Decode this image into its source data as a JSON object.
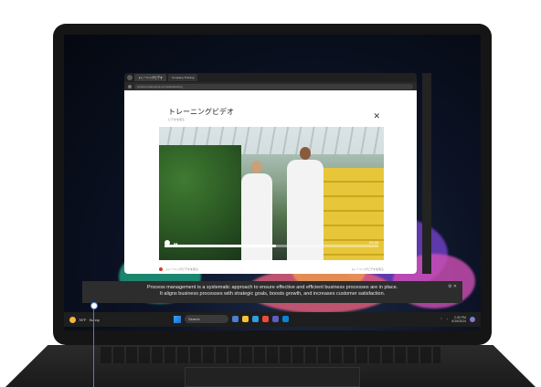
{
  "browser": {
    "tabs": [
      "トレーニングビデオ",
      "Company Training"
    ],
    "url": "contoso.sharepoint.com/sites/training"
  },
  "modal": {
    "title": "トレーニングビデオ",
    "subtitle": "ビデオを見る",
    "close_label": "✕"
  },
  "video": {
    "time": "03:45",
    "progress": 0.52
  },
  "footer": {
    "left": "トレーニングビデオを見る",
    "right": "トレーニングビデオを見る"
  },
  "caption": {
    "line1": "Process management is a systematic approach to ensure effective and efficient business processes are in place.",
    "line2": "It aligns business processes with strategic goals, boosts growth, and increases customer satisfaction.",
    "controls": "⚙ ✕"
  },
  "taskbar": {
    "weather_temp": "78°F",
    "weather_text": "Sunny",
    "search": "Search",
    "time": "2:30 PM",
    "date": "6/19/2024"
  },
  "colors": {
    "accent": "#3aa3f5",
    "record": "#d9382c"
  }
}
